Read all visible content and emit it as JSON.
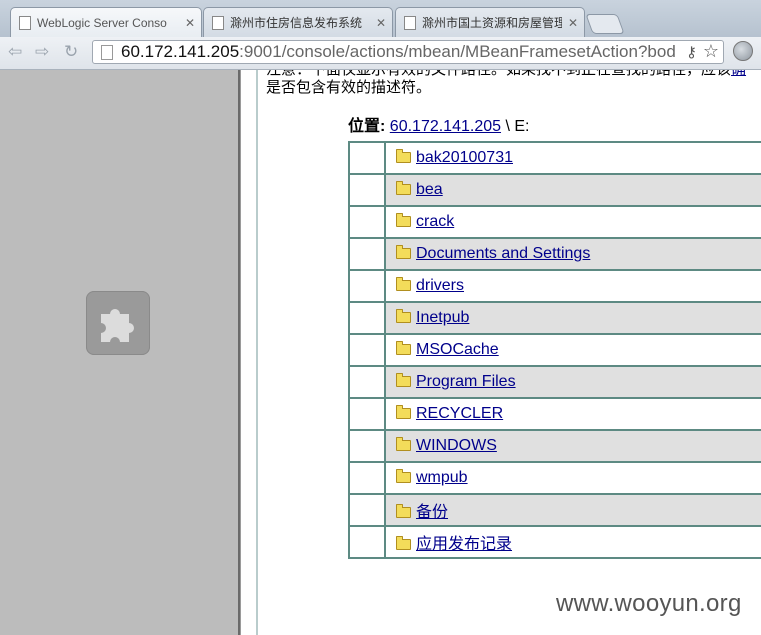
{
  "browser": {
    "tabs": [
      {
        "title": "WebLogic Server Conso",
        "active": true
      },
      {
        "title": "滁州市住房信息发布系统",
        "active": false
      },
      {
        "title": "滁州市国土资源和房屋管理",
        "active": false
      }
    ],
    "address": {
      "host": "60.172.141.205",
      "path": ":9001/console/actions/mbean/MBeanFramesetAction?bod"
    }
  },
  "notice": {
    "line1_start": "注意：下面仅显示有效的文件路径。如果找不到正在查找的路径，应该",
    "line1_link": "确",
    "line2": "是否包含有效的描述符。"
  },
  "location": {
    "label": "位置:",
    "host_link": "60.172.141.205",
    "suffix": " \\ E:"
  },
  "folders": [
    {
      "name": "bak20100731"
    },
    {
      "name": "bea"
    },
    {
      "name": "crack"
    },
    {
      "name": "Documents and Settings"
    },
    {
      "name": "drivers"
    },
    {
      "name": "Inetpub"
    },
    {
      "name": "MSOCache"
    },
    {
      "name": "Program Files"
    },
    {
      "name": "RECYCLER"
    },
    {
      "name": "WINDOWS"
    },
    {
      "name": "wmpub"
    },
    {
      "name": "备份"
    },
    {
      "name": "应用发布记录"
    }
  ],
  "watermark": "www.wooyun.org",
  "colors": {
    "table_border": "#5d8a83",
    "link": "#00008b",
    "alt_row": "#e0e0e0",
    "left_frame": "#bcbcbc"
  }
}
